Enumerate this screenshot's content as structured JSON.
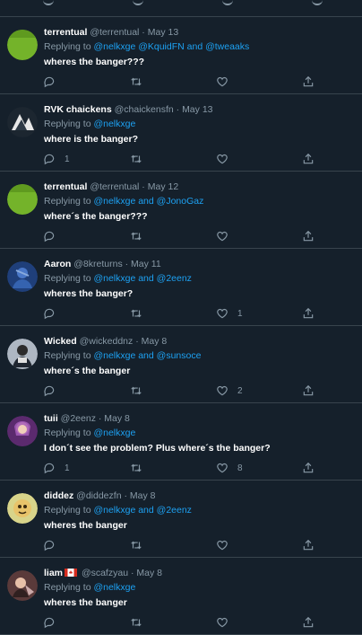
{
  "tweets": [
    {
      "name": "terrentual",
      "handle": "@terrentual",
      "date": "May 13",
      "replying_prefix": "Replying to",
      "replying_to": "@nelkxge @KquidFN and @tweaaks",
      "text": "wheres the banger???",
      "replies": "",
      "likes": "",
      "avatar_color": "#74b32a"
    },
    {
      "name": "RVK chaickens",
      "handle": "@chaickensfn",
      "date": "May 13",
      "replying_prefix": "Replying to",
      "replying_to": "@nelkxge",
      "text": "where is the banger?",
      "replies": "1",
      "likes": "",
      "avatar_color": "#1c2630"
    },
    {
      "name": "terrentual",
      "handle": "@terrentual",
      "date": "May 12",
      "replying_prefix": "Replying to",
      "replying_to": "@nelkxge and @JonoGaz",
      "text": "where´s the banger???",
      "replies": "",
      "likes": "",
      "avatar_color": "#74b32a"
    },
    {
      "name": "Aaron",
      "handle": "@8kreturns",
      "date": "May 11",
      "replying_prefix": "Replying to",
      "replying_to": "@nelkxge and @2eenz",
      "text": "wheres the banger?",
      "replies": "",
      "likes": "1",
      "avatar_color": "#2a59a8"
    },
    {
      "name": "Wicked",
      "handle": "@wickeddnz",
      "date": "May 8",
      "replying_prefix": "Replying to",
      "replying_to": "@nelkxge and @sunsoce",
      "text": "where´s the banger",
      "replies": "",
      "likes": "2",
      "avatar_color": "#3e4a58"
    },
    {
      "name": "tuii",
      "handle": "@2eenz",
      "date": "May 8",
      "replying_prefix": "Replying to",
      "replying_to": "@nelkxge",
      "text": "I don´t see the problem? Plus where´s the banger?",
      "replies": "1",
      "likes": "8",
      "avatar_color": "#a4579e"
    },
    {
      "name": "diddez",
      "handle": "@diddezfn",
      "date": "May 8",
      "replying_prefix": "Replying to",
      "replying_to": "@nelkxge and @2eenz",
      "text": "wheres the banger",
      "replies": "",
      "likes": "",
      "avatar_color": "#c4c46a"
    },
    {
      "name": "liam",
      "handle": "@scafzyau",
      "date": "May 8",
      "replying_prefix": "Replying to",
      "replying_to": "@nelkxge",
      "text": "wheres the banger",
      "replies": "",
      "likes": "",
      "avatar_color": "#5a3a3a"
    }
  ],
  "icons": {
    "reply": "reply-icon",
    "retweet": "retweet-icon",
    "like": "like-icon",
    "share": "share-icon"
  },
  "colors": {
    "background": "#15202b",
    "secondary_text": "#8899a6",
    "link": "#1da1f2",
    "divider": "#38444d"
  }
}
